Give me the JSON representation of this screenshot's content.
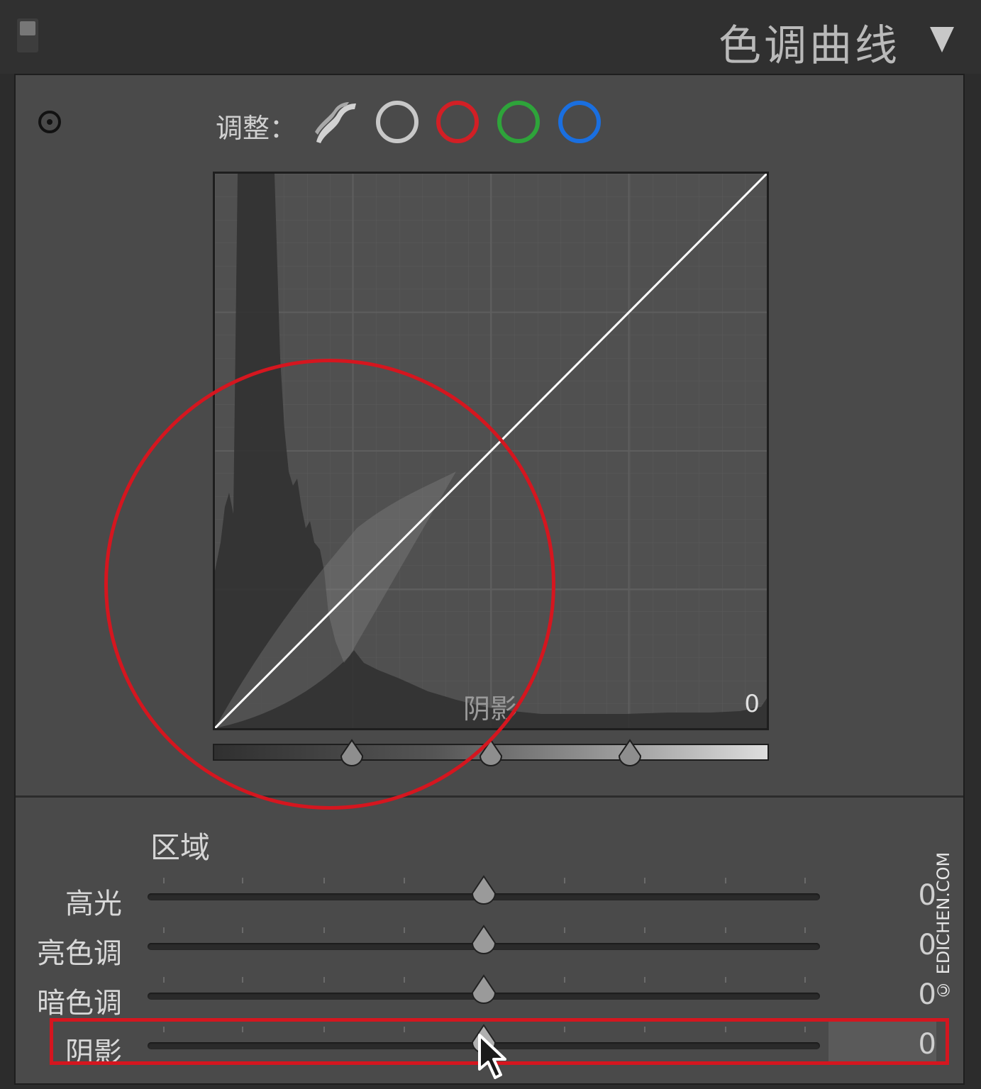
{
  "header": {
    "title": "色调曲线",
    "collapse_icon": "triangle-down-icon"
  },
  "toolbar": {
    "target_icon": "target-adjust-icon",
    "adjust_label": "调整：",
    "point_curve_icon": "point-curve-icon",
    "channels": [
      {
        "name": "rgb",
        "color": "#c8c8c8",
        "selected": false
      },
      {
        "name": "red",
        "color": "#d21f25",
        "selected": false
      },
      {
        "name": "green",
        "color": "#2ea43a",
        "selected": false
      },
      {
        "name": "blue",
        "color": "#1a6fe0",
        "selected": false
      }
    ]
  },
  "curve": {
    "region_name": "阴影",
    "region_value": "0",
    "split_points": [
      0.25,
      0.5,
      0.75
    ]
  },
  "region": {
    "label": "区域",
    "sliders": [
      {
        "label": "高光",
        "value": "0",
        "position": 0.5,
        "active": false
      },
      {
        "label": "亮色调",
        "value": "0",
        "position": 0.5,
        "active": false
      },
      {
        "label": "暗色调",
        "value": "0",
        "position": 0.5,
        "active": false
      },
      {
        "label": "阴影",
        "value": "0",
        "position": 0.5,
        "active": true
      }
    ]
  },
  "annotations": {
    "highlight_color": "#d5161f"
  },
  "watermark": "© EDICHEN.COM"
}
